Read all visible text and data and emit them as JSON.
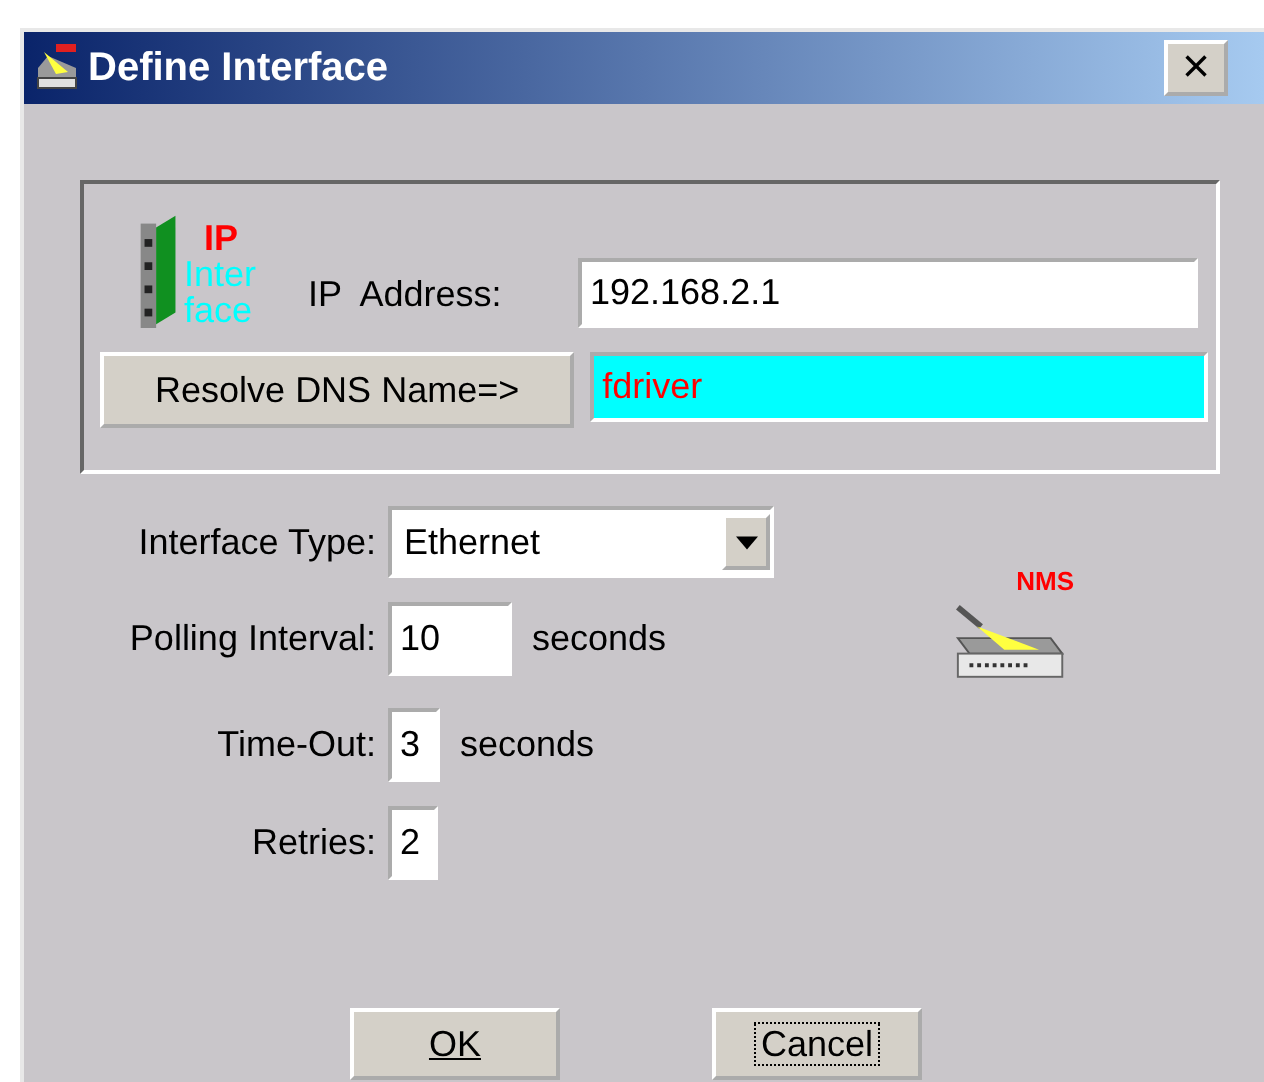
{
  "window": {
    "title": "Define Interface",
    "close": "×"
  },
  "address_group": {
    "logo": {
      "top": "IP",
      "middle": "Inter",
      "bottom": "face"
    },
    "ip_label": "IP  Address:",
    "ip_value": "192.168.2.1",
    "resolve_button": "Resolve DNS Name=>",
    "dns_value": "fdriver"
  },
  "fields": [
    {
      "kind": "select",
      "label": "Interface Type:",
      "value": "Ethernet"
    },
    {
      "kind": "text",
      "label": "Polling Interval:",
      "value": "10",
      "unit": "seconds"
    },
    {
      "kind": "text",
      "label": "Time-Out:",
      "value": "3",
      "unit": "seconds"
    },
    {
      "kind": "text",
      "label": "Retries:",
      "value": "2"
    }
  ],
  "nms_logo": "NMS",
  "buttons": [
    {
      "label": "OK",
      "mnemonic": true,
      "focused": false
    },
    {
      "label": "Cancel",
      "mnemonic": false,
      "focused": true
    }
  ]
}
